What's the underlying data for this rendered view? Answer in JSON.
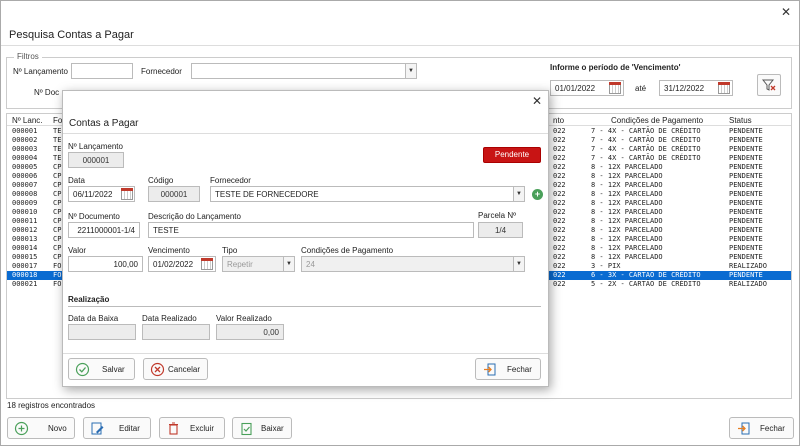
{
  "window": {
    "title": "Pesquisa Contas a Pagar",
    "close": "✕"
  },
  "filters": {
    "legend": "Filtros",
    "lancamento_label": "Nº Lançamento",
    "lancamento_value": "",
    "fornecedor_label": "Fornecedor",
    "fornecedor_value": "",
    "documento_label": "Nº Doc",
    "period_title": "Informe o período de 'Vencimento'",
    "date_from": "01/01/2022",
    "ate_label": "até",
    "date_to": "31/12/2022"
  },
  "grid": {
    "columns": {
      "lanc": "Nº Lanc.",
      "fo": "Fo",
      "nto": "nto",
      "cond": "Condições de Pagamento",
      "status": "Status"
    },
    "rows": [
      {
        "lanc": "000001",
        "fo": "TE",
        "year": "022",
        "cond": "7 - 4X - CARTÃO DE CRÉDITO",
        "status": "PENDENTE"
      },
      {
        "lanc": "000002",
        "fo": "TE",
        "year": "022",
        "cond": "7 - 4X - CARTÃO DE CRÉDITO",
        "status": "PENDENTE"
      },
      {
        "lanc": "000003",
        "fo": "TE",
        "year": "022",
        "cond": "7 - 4X - CARTÃO DE CRÉDITO",
        "status": "PENDENTE"
      },
      {
        "lanc": "000004",
        "fo": "TE",
        "year": "022",
        "cond": "7 - 4X - CARTÃO DE CRÉDITO",
        "status": "PENDENTE"
      },
      {
        "lanc": "000005",
        "fo": "CP",
        "year": "022",
        "cond": "8 - 12X PARCELADO",
        "status": "PENDENTE"
      },
      {
        "lanc": "000006",
        "fo": "CP",
        "year": "022",
        "cond": "8 - 12X PARCELADO",
        "status": "PENDENTE"
      },
      {
        "lanc": "000007",
        "fo": "CP",
        "year": "022",
        "cond": "8 - 12X PARCELADO",
        "status": "PENDENTE"
      },
      {
        "lanc": "000008",
        "fo": "CP",
        "year": "022",
        "cond": "8 - 12X PARCELADO",
        "status": "PENDENTE"
      },
      {
        "lanc": "000009",
        "fo": "CP",
        "year": "022",
        "cond": "8 - 12X PARCELADO",
        "status": "PENDENTE"
      },
      {
        "lanc": "000010",
        "fo": "CP",
        "year": "022",
        "cond": "8 - 12X PARCELADO",
        "status": "PENDENTE"
      },
      {
        "lanc": "000011",
        "fo": "CP",
        "year": "022",
        "cond": "8 - 12X PARCELADO",
        "status": "PENDENTE"
      },
      {
        "lanc": "000012",
        "fo": "CP",
        "year": "022",
        "cond": "8 - 12X PARCELADO",
        "status": "PENDENTE"
      },
      {
        "lanc": "000013",
        "fo": "CP",
        "year": "022",
        "cond": "8 - 12X PARCELADO",
        "status": "PENDENTE"
      },
      {
        "lanc": "000014",
        "fo": "CP",
        "year": "022",
        "cond": "8 - 12X PARCELADO",
        "status": "PENDENTE"
      },
      {
        "lanc": "000015",
        "fo": "CP",
        "year": "022",
        "cond": "8 - 12X PARCELADO",
        "status": "PENDENTE"
      },
      {
        "lanc": "000017",
        "fo": "FO",
        "year": "022",
        "cond": "3 - PIX",
        "status": "REALIZADO"
      },
      {
        "lanc": "000018",
        "fo": "FO",
        "year": "022",
        "cond": "6 - 3X - CARTÃO DE CRÉDITO",
        "status": "PENDENTE"
      },
      {
        "lanc": "000021",
        "fo": "FO",
        "year": "022",
        "cond": "5 - 2X - CARTÃO DE CRÉDITO",
        "status": "REALIZADO"
      }
    ],
    "selected_index": 16
  },
  "footer": {
    "count": "18 registros encontrados",
    "novo": "Novo",
    "editar": "Editar",
    "excluir": "Excluir",
    "baixar": "Baixar",
    "fechar": "Fechar"
  },
  "modal": {
    "title": "Contas a Pagar",
    "close": "✕",
    "lancamento_label": "Nº Lançamento",
    "lancamento_value": "000001",
    "status_button": "Pendente",
    "data_label": "Data",
    "data_value": "06/11/2022",
    "codigo_label": "Código",
    "codigo_value": "000001",
    "fornecedor_label": "Fornecedor",
    "fornecedor_value": "TESTE DE FORNECEDORE",
    "documento_label": "Nº Documento",
    "documento_value": "2211000001-1/4",
    "descricao_label": "Descrição do Lançamento",
    "descricao_value": "TESTE",
    "parcela_label": "Parcela Nº",
    "parcela_value": "1/4",
    "valor_label": "Valor",
    "valor_value": "100,00",
    "vencimento_label": "Vencimento",
    "vencimento_value": "01/02/2022",
    "tipo_label": "Tipo",
    "tipo_value": "Repetir",
    "condicoes_label": "Condições de Pagamento",
    "condicoes_value": "24",
    "realizacao_title": "Realização",
    "data_baixa_label": "Data da Baixa",
    "data_baixa_value": "",
    "data_realizado_label": "Data Realizado",
    "data_realizado_value": "",
    "valor_realizado_label": "Valor Realizado",
    "valor_realizado_value": "0,00",
    "salvar": "Salvar",
    "cancelar": "Cancelar",
    "fechar": "Fechar"
  },
  "colors": {
    "selected_row": "#0a6bd1",
    "pending_button": "#c81414",
    "accent_green": "#4aa05a"
  }
}
